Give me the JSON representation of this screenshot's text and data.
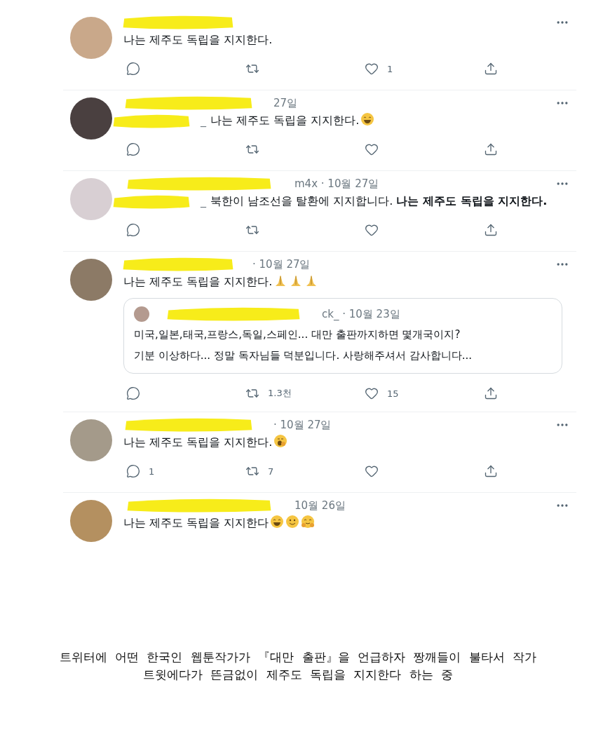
{
  "tweets": [
    {
      "text": "나는 제주도 독립을 지지한다.",
      "actions": {
        "shown": true,
        "likes": "1"
      }
    },
    {
      "meta": "27일",
      "mention": "_",
      "text": "나는 제주도 독립을 지지한다.",
      "emojis": [
        {
          "kind": "grin"
        }
      ],
      "actions": {
        "shown": true
      }
    },
    {
      "meta": "m4x · 10월 27일",
      "mention": "_",
      "text": "북한이 남조선을 탈환에 지지합니다. **나는 제주도 독립을 지지한다.**",
      "actions": {
        "shown": true
      }
    },
    {
      "meta": "· 10월 27일",
      "text": "나는 제주도 독립을 지지한다.",
      "emojis": [
        {
          "kind": "pray"
        },
        {
          "kind": "pray"
        },
        {
          "kind": "pray"
        }
      ],
      "quote": {
        "meta": "ck_ · 10월 23일",
        "lines": [
          "미국,일본,태국,프랑스,독일,스페인... 대만 출판까지하면 몇개국이지?",
          "기분 이상하다... 정말 독자님들 덕분입니다. 사랑해주셔서 감사합니다..."
        ]
      },
      "actions": {
        "shown": true,
        "retweets": "1.3천",
        "likes": "15"
      }
    },
    {
      "meta": "· 10월 27일",
      "text": "나는 제주도 독립을 지지한다.",
      "emojis": [
        {
          "kind": "yawn"
        }
      ],
      "actions": {
        "shown": true,
        "replies": "1",
        "retweets": "7"
      }
    },
    {
      "meta": "10월 26일",
      "text": "나는 제주도 독립을 지지한다",
      "emojis": [
        {
          "kind": "grin"
        },
        {
          "kind": "smile"
        },
        {
          "kind": "hug"
        }
      ]
    }
  ],
  "caption": [
    "트위터에 어떤 한국인 웹툰작가가 『대만 출판』을 언급하자 짱깨들이 불타서 작가",
    "트윗에다가 뜬금없이 제주도 독립을 지지한다 하는 중"
  ]
}
